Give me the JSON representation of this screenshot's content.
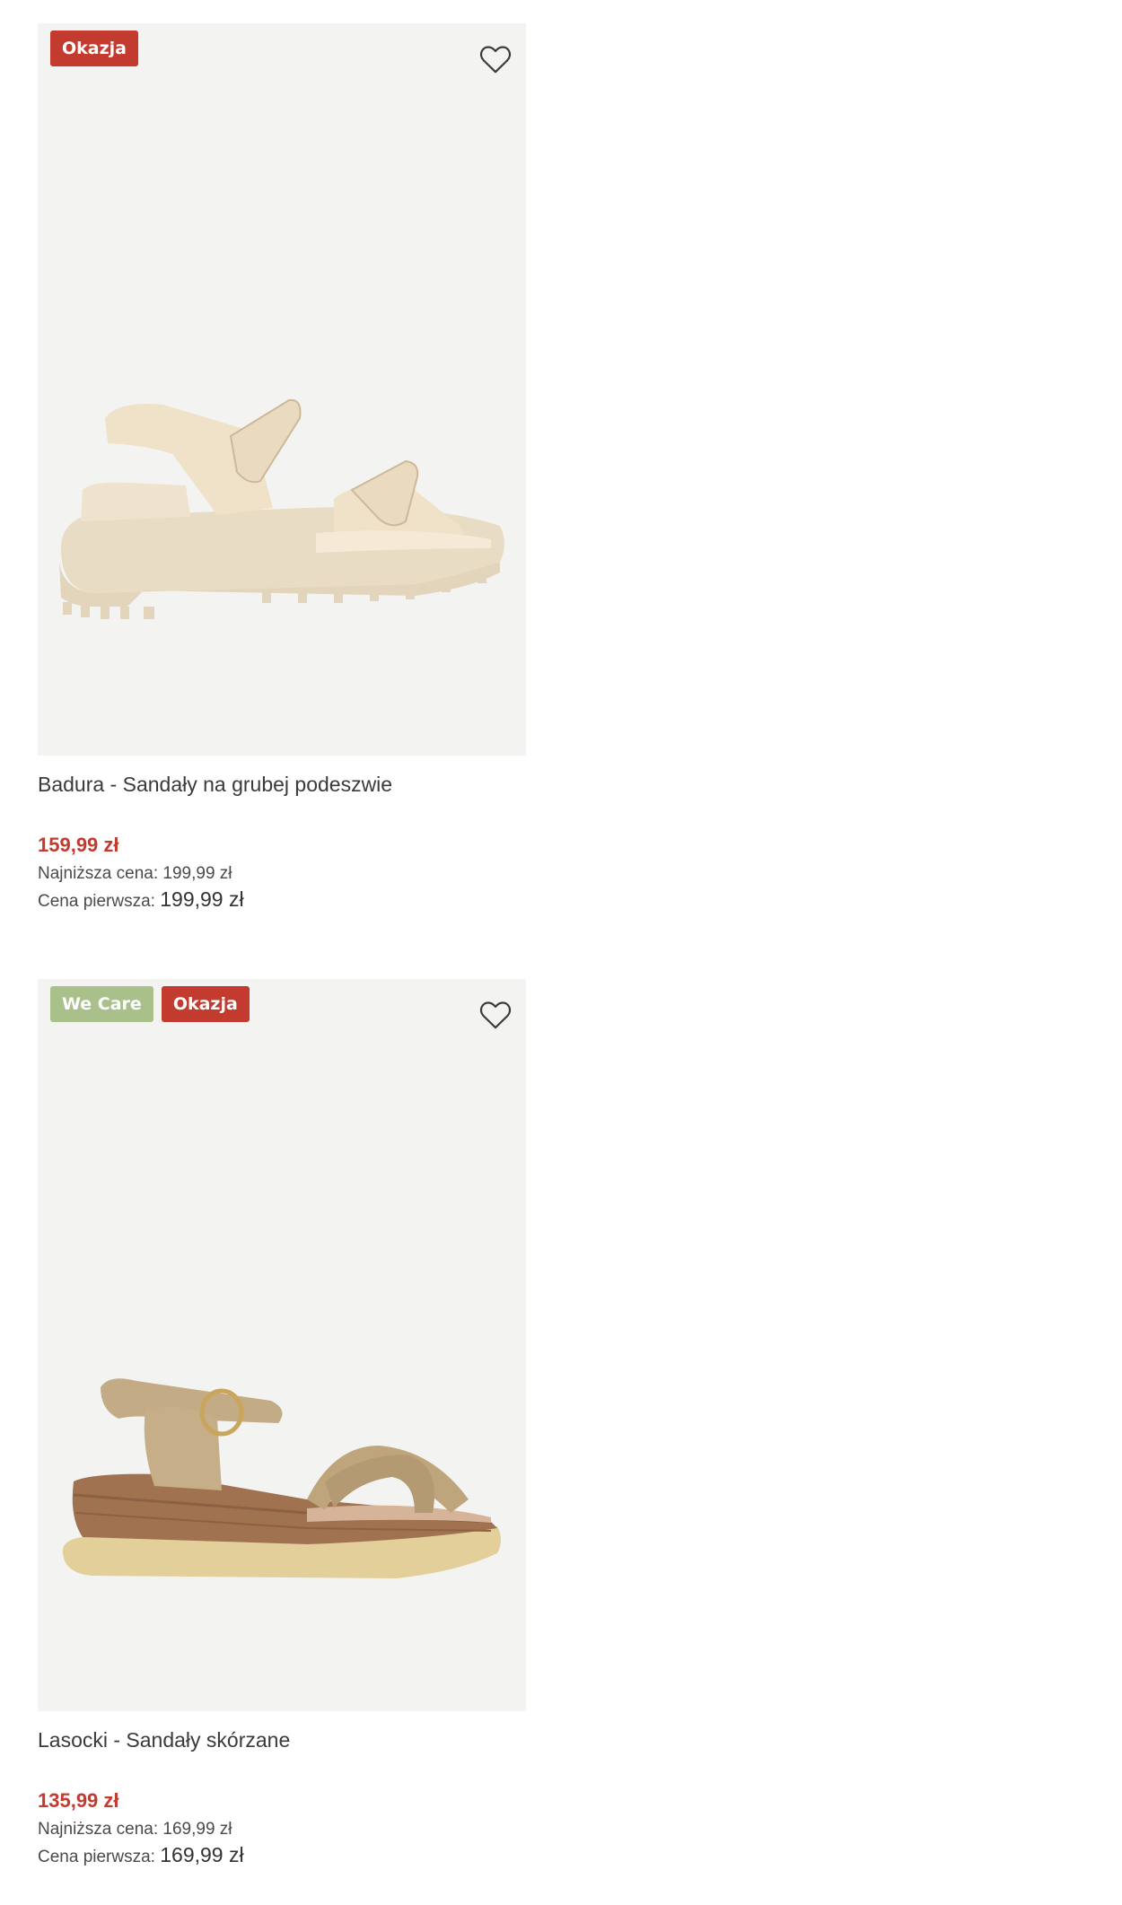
{
  "products": [
    {
      "badges": [
        "Okazja"
      ],
      "name": "Badura - Sandały na grubej podeszwie",
      "price": "159,99 zł",
      "lowest_label": "Najniższa cena:",
      "lowest_value": "199,99 zł",
      "first_label": "Cena pierwsza:",
      "first_value": "199,99 zł"
    },
    {
      "badges": [
        "We Care",
        "Okazja"
      ],
      "name": "Lasocki - Sandały skórzane",
      "price": "135,99 zł",
      "lowest_label": "Najniższa cena:",
      "lowest_value": "169,99 zł",
      "first_label": "Cena pierwsza:",
      "first_value": "169,99 zł"
    }
  ],
  "colors": {
    "sale_red": "#c33a2f",
    "wecare_green": "#a9c08a",
    "image_bg": "#f3f4f2"
  },
  "icons": {
    "favorite": "heart-outline-icon"
  }
}
